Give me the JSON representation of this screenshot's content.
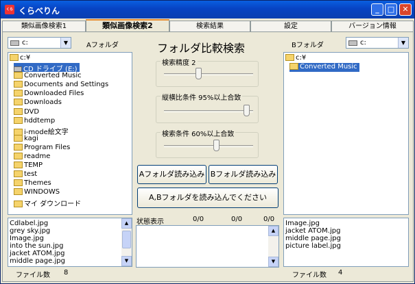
{
  "window": {
    "title": "くらべりん",
    "app_icon": "くら"
  },
  "tabs": [
    "類似画像検索1",
    "類似画像検索2",
    "検索結果",
    "設定",
    "バージョン情報"
  ],
  "left": {
    "drive_value": "c:",
    "folder_label": "Aフォルダ",
    "tree_root": "c:¥",
    "tree_items": [
      "CD ドライブ (E:)",
      "Converted Music",
      "Documents and Settings",
      "Downloaded Files",
      "Downloads",
      "DVD",
      "hddtemp",
      "i-mode絵文字",
      "kagi",
      "Program Files",
      "readme",
      "TEMP",
      "test",
      "Themes",
      "WINDOWS",
      "マイ ダウンロード"
    ],
    "files": [
      "Cdlabel.jpg",
      "grey sky.jpg",
      "Image.jpg",
      "into the sun.jpg",
      "jacket ATOM.jpg",
      "middle page.jpg"
    ],
    "file_count_label": "ファイル数",
    "file_count": "8"
  },
  "center": {
    "heading": "フォルダ比較検索",
    "precision_label": "検索精度  2",
    "precision_level": 0.4,
    "ratio_label": "縦横比条件  95%以上合致",
    "ratio_level": 0.95,
    "match_label": "検索条件   60%以上合致",
    "match_level": 0.6,
    "load_a_label": "Aフォルダ読み込み",
    "load_b_label": "Bフォルダ読み込み",
    "instruction_label": "A,Bフォルダを読み込んでください",
    "status_label": "状態表示",
    "status_counts": [
      "0/0",
      "0/0",
      "0/0"
    ]
  },
  "right": {
    "drive_value": "c:",
    "folder_label": "Bフォルダ",
    "tree_root": "c:¥",
    "tree_items": [
      "Converted Music"
    ],
    "files": [
      "Image.jpg",
      "jacket ATOM.jpg",
      "middle page.jpg",
      "picture label.jpg"
    ],
    "file_count_label": "ファイル数",
    "file_count": "4"
  }
}
